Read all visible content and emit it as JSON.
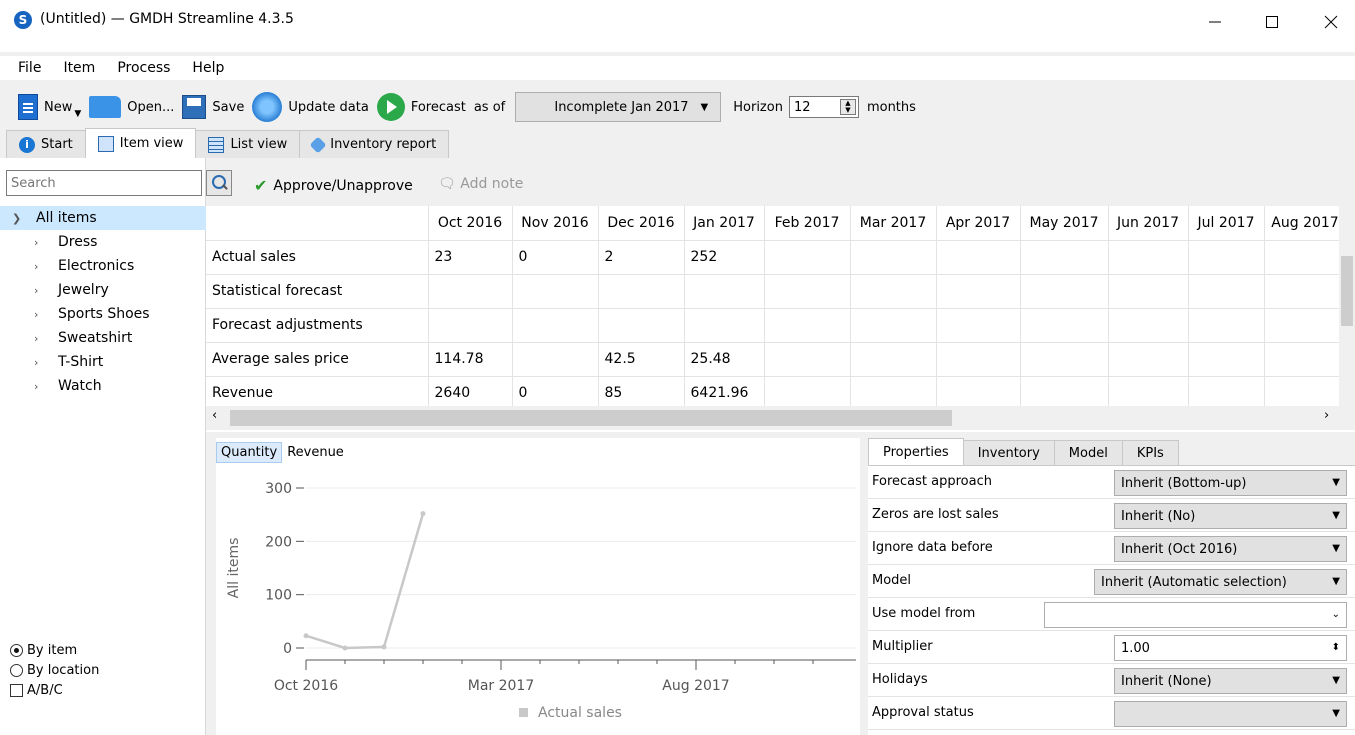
{
  "window": {
    "title": "(Untitled) — GMDH Streamline 4.3.5",
    "logo": "S"
  },
  "menu": [
    {
      "label": "File"
    },
    {
      "label": "Item"
    },
    {
      "label": "Process"
    },
    {
      "label": "Help"
    }
  ],
  "toolbar": {
    "new_label": "New",
    "open_label": "Open...",
    "save_label": "Save",
    "update_label": "Update data",
    "forecast_label": "Forecast",
    "as_of_label": "as of",
    "period_value": "Incomplete Jan 2017",
    "horizon_label": "Horizon",
    "horizon_value": "12",
    "months_label": "months"
  },
  "tabs": [
    {
      "label": "Start",
      "icon": "info-icon"
    },
    {
      "label": "Item view",
      "icon": "chart-icon",
      "active": true
    },
    {
      "label": "List view",
      "icon": "table-icon"
    },
    {
      "label": "Inventory report",
      "icon": "tag-icon"
    }
  ],
  "search": {
    "placeholder": "Search"
  },
  "actions": {
    "approve": "Approve/Unapprove",
    "add_note": "Add note"
  },
  "tree": {
    "root": "All items",
    "children": [
      "Dress",
      "Electronics",
      "Jewelry",
      "Sports Shoes",
      "Sweatshirt",
      "T-Shirt",
      "Watch"
    ]
  },
  "view_options": {
    "by_item": "By item",
    "by_location": "By location",
    "abc": "A/B/C"
  },
  "grid": {
    "columns": [
      "Oct 2016",
      "Nov 2016",
      "Dec 2016",
      "Jan 2017",
      "Feb 2017",
      "Mar 2017",
      "Apr 2017",
      "May 2017",
      "Jun 2017",
      "Jul 2017",
      "Aug 2017"
    ],
    "rows": [
      {
        "label": "Actual sales",
        "cells": [
          "23",
          "0",
          "2",
          "252",
          "",
          "",
          "",
          "",
          "",
          "",
          ""
        ]
      },
      {
        "label": "Statistical forecast",
        "cells": [
          "",
          "",
          "",
          "",
          "",
          "",
          "",
          "",
          "",
          "",
          ""
        ]
      },
      {
        "label": "Forecast adjustments",
        "cells": [
          "",
          "",
          "",
          "",
          "",
          "",
          "",
          "",
          "",
          "",
          ""
        ]
      },
      {
        "label": "Average sales price",
        "cells": [
          "114.78",
          "",
          "42.5",
          "25.48",
          "",
          "",
          "",
          "",
          "",
          "",
          ""
        ]
      },
      {
        "label": "Revenue",
        "cells": [
          "2640",
          "0",
          "85",
          "6421.96",
          "",
          "",
          "",
          "",
          "",
          "",
          ""
        ]
      }
    ]
  },
  "chart_tabs": {
    "quantity": "Quantity",
    "revenue": "Revenue"
  },
  "chart_data": {
    "type": "line",
    "ylabel": "All items",
    "ylim": [
      0,
      300
    ],
    "yticks": [
      0,
      100,
      200,
      300
    ],
    "xtick_labels": [
      "Oct 2016",
      "Mar 2017",
      "Aug 2017"
    ],
    "series": [
      {
        "name": "Actual sales",
        "x": [
          "Oct 2016",
          "Nov 2016",
          "Dec 2016",
          "Jan 2017"
        ],
        "values": [
          23,
          0,
          2,
          252
        ],
        "color": "#c8c8c8"
      }
    ],
    "legend": "bottom",
    "grid": true
  },
  "props_tabs": [
    "Properties",
    "Inventory",
    "Model",
    "KPIs"
  ],
  "properties": [
    {
      "label": "Forecast approach",
      "value": "Inherit (Bottom-up)",
      "kind": "select"
    },
    {
      "label": "Zeros are lost sales",
      "value": "Inherit (No)",
      "kind": "select"
    },
    {
      "label": "Ignore data before",
      "value": "Inherit (Oct 2016)",
      "kind": "select"
    },
    {
      "label": "Model",
      "value": "Inherit (Automatic selection)",
      "kind": "select-wide"
    },
    {
      "label": "Use model from",
      "value": "",
      "kind": "combo"
    },
    {
      "label": "Multiplier",
      "value": "1.00",
      "kind": "spin"
    },
    {
      "label": "Holidays",
      "value": "Inherit (None)",
      "kind": "select"
    },
    {
      "label": "Approval status",
      "value": "",
      "kind": "select"
    }
  ]
}
